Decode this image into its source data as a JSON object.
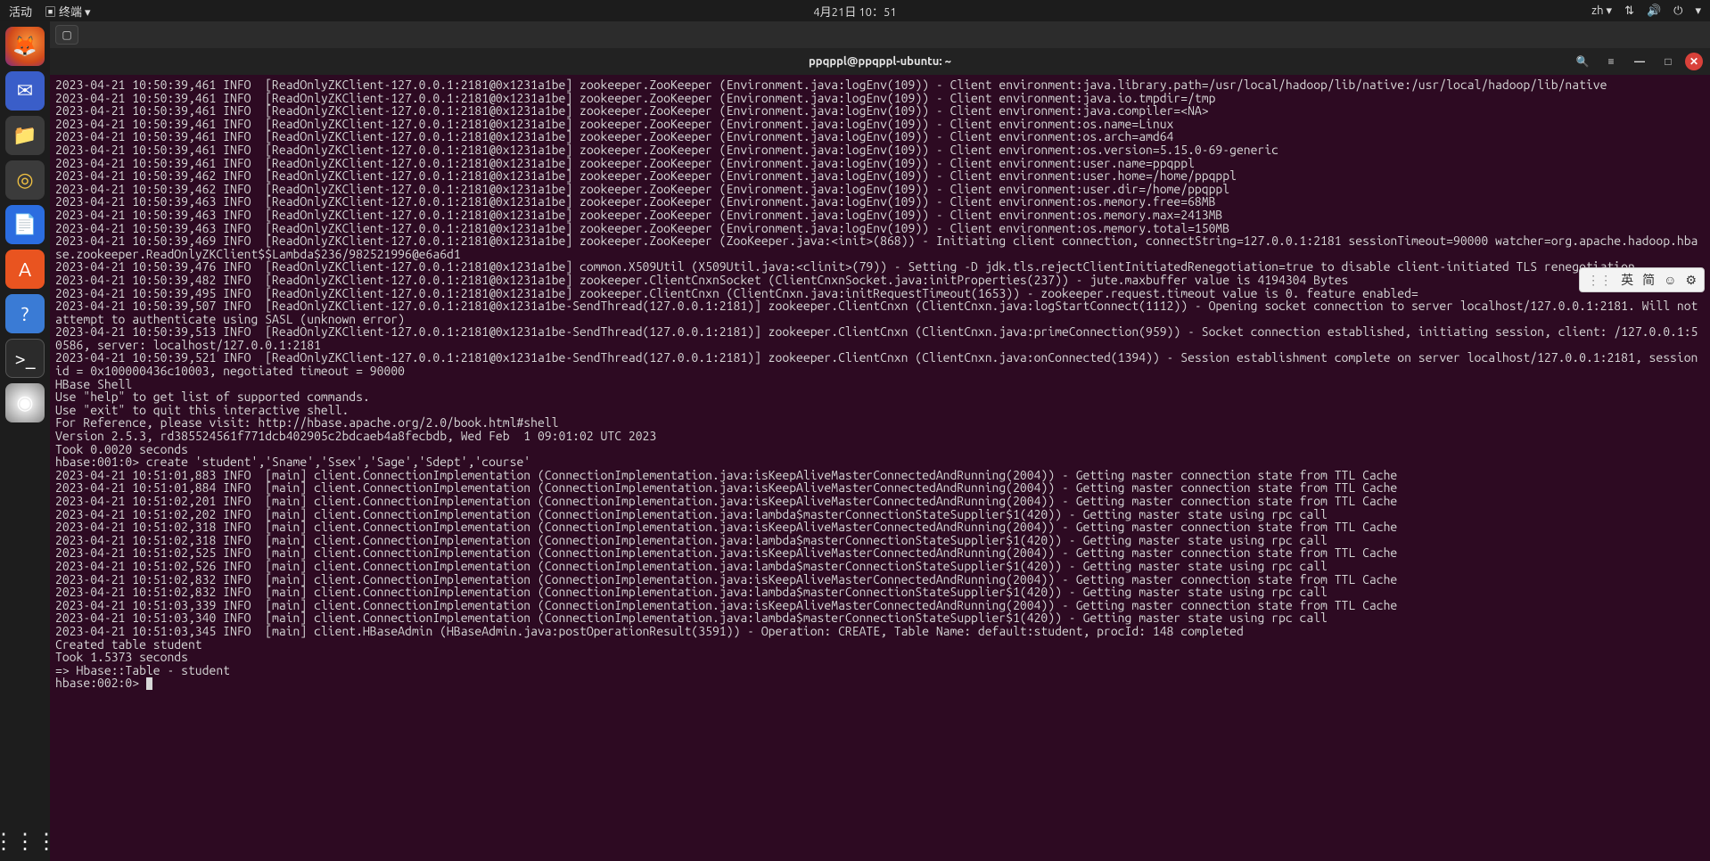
{
  "topbar": {
    "activities_label": "活动",
    "app_label": "终端",
    "datetime": "4月21日 10：51",
    "lang": "zh",
    "network_icon": "network-icon",
    "volume_icon": "volume-icon",
    "power_icon": "power-icon"
  },
  "window": {
    "title": "ppqppl@ppqppl-ubuntu: ~",
    "newtab_glyph": "▢",
    "search_glyph": "🔍",
    "menu_glyph": "≡",
    "min_glyph": "—",
    "max_glyph": "□",
    "close_glyph": "✕"
  },
  "ime": {
    "lang_glyph": "英",
    "mode_glyph": "简",
    "emoji_glyph": "☺",
    "gear_glyph": "⚙"
  },
  "dock": {
    "firefox": "🦊",
    "mail": "✉",
    "files": "📁",
    "music": "◎",
    "writer": "📄",
    "store": "A",
    "help": "?",
    "terminal": ">_",
    "dvd": "◉",
    "grid": "⋮⋮⋮"
  },
  "terminal": {
    "lines": [
      "2023-04-21 10:50:39,461 INFO  [ReadOnlyZKClient-127.0.0.1:2181@0x1231a1be] zookeeper.ZooKeeper (Environment.java:logEnv(109)) - Client environment:java.library.path=/usr/local/hadoop/lib/native:/usr/local/hadoop/lib/native",
      "2023-04-21 10:50:39,461 INFO  [ReadOnlyZKClient-127.0.0.1:2181@0x1231a1be] zookeeper.ZooKeeper (Environment.java:logEnv(109)) - Client environment:java.io.tmpdir=/tmp",
      "2023-04-21 10:50:39,461 INFO  [ReadOnlyZKClient-127.0.0.1:2181@0x1231a1be] zookeeper.ZooKeeper (Environment.java:logEnv(109)) - Client environment:java.compiler=<NA>",
      "2023-04-21 10:50:39,461 INFO  [ReadOnlyZKClient-127.0.0.1:2181@0x1231a1be] zookeeper.ZooKeeper (Environment.java:logEnv(109)) - Client environment:os.name=Linux",
      "2023-04-21 10:50:39,461 INFO  [ReadOnlyZKClient-127.0.0.1:2181@0x1231a1be] zookeeper.ZooKeeper (Environment.java:logEnv(109)) - Client environment:os.arch=amd64",
      "2023-04-21 10:50:39,461 INFO  [ReadOnlyZKClient-127.0.0.1:2181@0x1231a1be] zookeeper.ZooKeeper (Environment.java:logEnv(109)) - Client environment:os.version=5.15.0-69-generic",
      "2023-04-21 10:50:39,461 INFO  [ReadOnlyZKClient-127.0.0.1:2181@0x1231a1be] zookeeper.ZooKeeper (Environment.java:logEnv(109)) - Client environment:user.name=ppqppl",
      "2023-04-21 10:50:39,462 INFO  [ReadOnlyZKClient-127.0.0.1:2181@0x1231a1be] zookeeper.ZooKeeper (Environment.java:logEnv(109)) - Client environment:user.home=/home/ppqppl",
      "2023-04-21 10:50:39,462 INFO  [ReadOnlyZKClient-127.0.0.1:2181@0x1231a1be] zookeeper.ZooKeeper (Environment.java:logEnv(109)) - Client environment:user.dir=/home/ppqppl",
      "2023-04-21 10:50:39,463 INFO  [ReadOnlyZKClient-127.0.0.1:2181@0x1231a1be] zookeeper.ZooKeeper (Environment.java:logEnv(109)) - Client environment:os.memory.free=68MB",
      "2023-04-21 10:50:39,463 INFO  [ReadOnlyZKClient-127.0.0.1:2181@0x1231a1be] zookeeper.ZooKeeper (Environment.java:logEnv(109)) - Client environment:os.memory.max=2413MB",
      "2023-04-21 10:50:39,463 INFO  [ReadOnlyZKClient-127.0.0.1:2181@0x1231a1be] zookeeper.ZooKeeper (Environment.java:logEnv(109)) - Client environment:os.memory.total=150MB",
      "2023-04-21 10:50:39,469 INFO  [ReadOnlyZKClient-127.0.0.1:2181@0x1231a1be] zookeeper.ZooKeeper (ZooKeeper.java:<init>(868)) - Initiating client connection, connectString=127.0.0.1:2181 sessionTimeout=90000 watcher=org.apache.hadoop.hbase.zookeeper.ReadOnlyZKClient$$Lambda$236/982521996@e6a6d1",
      "2023-04-21 10:50:39,476 INFO  [ReadOnlyZKClient-127.0.0.1:2181@0x1231a1be] common.X509Util (X509Util.java:<clinit>(79)) - Setting -D jdk.tls.rejectClientInitiatedRenegotiation=true to disable client-initiated TLS renegotiation",
      "2023-04-21 10:50:39,482 INFO  [ReadOnlyZKClient-127.0.0.1:2181@0x1231a1be] zookeeper.ClientCnxnSocket (ClientCnxnSocket.java:initProperties(237)) - jute.maxbuffer value is 4194304 Bytes",
      "2023-04-21 10:50:39,495 INFO  [ReadOnlyZKClient-127.0.0.1:2181@0x1231a1be] zookeeper.ClientCnxn (ClientCnxn.java:initRequestTimeout(1653)) - zookeeper.request.timeout value is 0. feature enabled=",
      "2023-04-21 10:50:39,507 INFO  [ReadOnlyZKClient-127.0.0.1:2181@0x1231a1be-SendThread(127.0.0.1:2181)] zookeeper.ClientCnxn (ClientCnxn.java:logStartConnect(1112)) - Opening socket connection to server localhost/127.0.0.1:2181. Will not attempt to authenticate using SASL (unknown error)",
      "2023-04-21 10:50:39,513 INFO  [ReadOnlyZKClient-127.0.0.1:2181@0x1231a1be-SendThread(127.0.0.1:2181)] zookeeper.ClientCnxn (ClientCnxn.java:primeConnection(959)) - Socket connection established, initiating session, client: /127.0.0.1:50586, server: localhost/127.0.0.1:2181",
      "2023-04-21 10:50:39,521 INFO  [ReadOnlyZKClient-127.0.0.1:2181@0x1231a1be-SendThread(127.0.0.1:2181)] zookeeper.ClientCnxn (ClientCnxn.java:onConnected(1394)) - Session establishment complete on server localhost/127.0.0.1:2181, sessionid = 0x100000436c10003, negotiated timeout = 90000",
      "HBase Shell",
      "Use \"help\" to get list of supported commands.",
      "Use \"exit\" to quit this interactive shell.",
      "For Reference, please visit: http://hbase.apache.org/2.0/book.html#shell",
      "Version 2.5.3, rd385524561f771dcb402905c2bdcaeb4a8fecbdb, Wed Feb  1 09:01:02 UTC 2023",
      "Took 0.0020 seconds",
      "hbase:001:0> create 'student','Sname','Ssex','Sage','Sdept','course'",
      "2023-04-21 10:51:01,883 INFO  [main] client.ConnectionImplementation (ConnectionImplementation.java:isKeepAliveMasterConnectedAndRunning(2004)) - Getting master connection state from TTL Cache",
      "2023-04-21 10:51:01,884 INFO  [main] client.ConnectionImplementation (ConnectionImplementation.java:isKeepAliveMasterConnectedAndRunning(2004)) - Getting master connection state from TTL Cache",
      "2023-04-21 10:51:02,201 INFO  [main] client.ConnectionImplementation (ConnectionImplementation.java:isKeepAliveMasterConnectedAndRunning(2004)) - Getting master connection state from TTL Cache",
      "2023-04-21 10:51:02,202 INFO  [main] client.ConnectionImplementation (ConnectionImplementation.java:lambda$masterConnectionStateSupplier$1(420)) - Getting master state using rpc call",
      "2023-04-21 10:51:02,318 INFO  [main] client.ConnectionImplementation (ConnectionImplementation.java:isKeepAliveMasterConnectedAndRunning(2004)) - Getting master connection state from TTL Cache",
      "2023-04-21 10:51:02,318 INFO  [main] client.ConnectionImplementation (ConnectionImplementation.java:lambda$masterConnectionStateSupplier$1(420)) - Getting master state using rpc call",
      "2023-04-21 10:51:02,525 INFO  [main] client.ConnectionImplementation (ConnectionImplementation.java:isKeepAliveMasterConnectedAndRunning(2004)) - Getting master connection state from TTL Cache",
      "2023-04-21 10:51:02,526 INFO  [main] client.ConnectionImplementation (ConnectionImplementation.java:lambda$masterConnectionStateSupplier$1(420)) - Getting master state using rpc call",
      "2023-04-21 10:51:02,832 INFO  [main] client.ConnectionImplementation (ConnectionImplementation.java:isKeepAliveMasterConnectedAndRunning(2004)) - Getting master connection state from TTL Cache",
      "2023-04-21 10:51:02,832 INFO  [main] client.ConnectionImplementation (ConnectionImplementation.java:lambda$masterConnectionStateSupplier$1(420)) - Getting master state using rpc call",
      "2023-04-21 10:51:03,339 INFO  [main] client.ConnectionImplementation (ConnectionImplementation.java:isKeepAliveMasterConnectedAndRunning(2004)) - Getting master connection state from TTL Cache",
      "2023-04-21 10:51:03,340 INFO  [main] client.ConnectionImplementation (ConnectionImplementation.java:lambda$masterConnectionStateSupplier$1(420)) - Getting master state using rpc call",
      "2023-04-21 10:51:03,345 INFO  [main] client.HBaseAdmin (HBaseAdmin.java:postOperationResult(3591)) - Operation: CREATE, Table Name: default:student, procId: 148 completed",
      "Created table student",
      "Took 1.5373 seconds",
      "=> Hbase::Table - student"
    ],
    "prompt": "hbase:002:0> "
  }
}
